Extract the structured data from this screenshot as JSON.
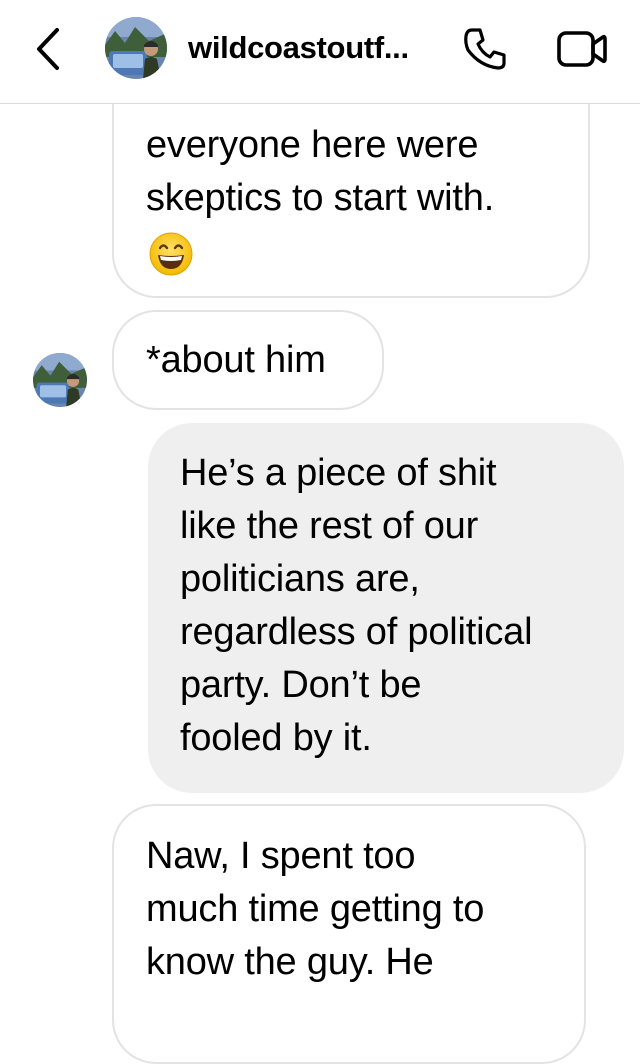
{
  "header": {
    "username": "wildcoastoutf..."
  },
  "colors": {
    "incoming_border": "#e3e3e3",
    "outgoing_background": "#efefef",
    "divider": "#dbdbdb"
  },
  "icons": {
    "back": "chevron-left-icon",
    "call": "phone-icon",
    "video": "video-camera-icon",
    "emoji": "grinning-face-emoji"
  },
  "messages": [
    {
      "direction": "incoming",
      "lines": [
        "everyone here were",
        "skeptics to start with."
      ],
      "emoji": "grinning face"
    },
    {
      "direction": "incoming",
      "lines": [
        "*about him"
      ]
    },
    {
      "direction": "outgoing",
      "lines": [
        "He’s a piece of shit",
        "like the rest of our",
        "politicians are,",
        "regardless of political",
        "party. Don’t be",
        "fooled by it."
      ]
    },
    {
      "direction": "incoming",
      "lines": [
        "Naw, I spent too",
        "much time getting to",
        "know the guy. He"
      ]
    }
  ]
}
